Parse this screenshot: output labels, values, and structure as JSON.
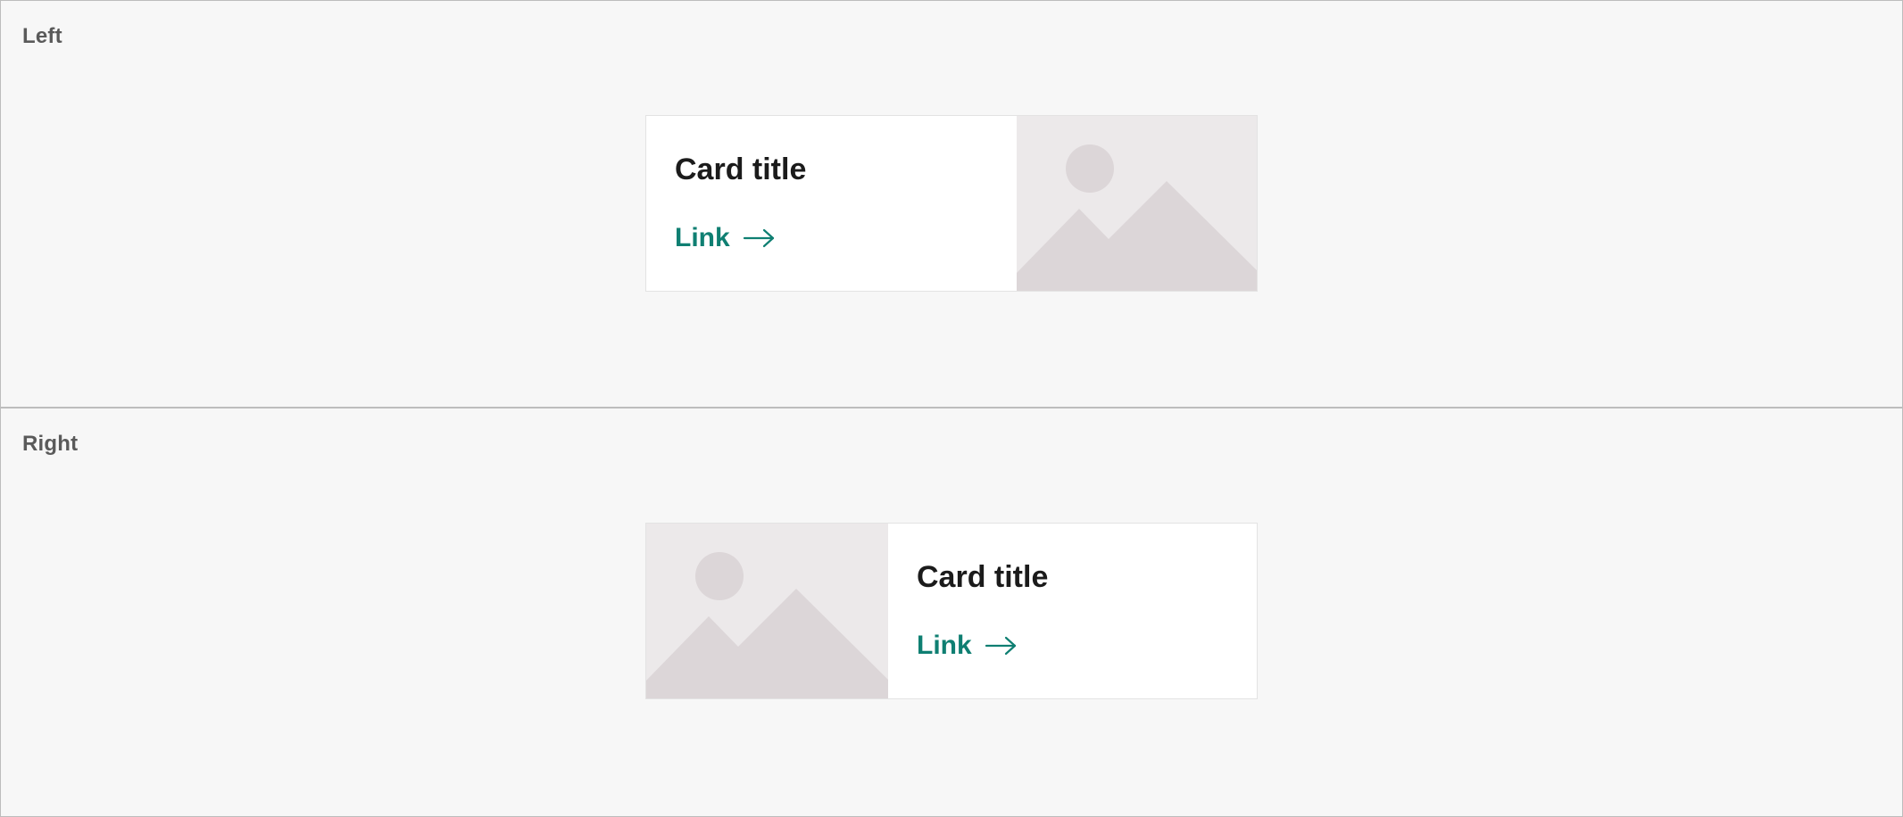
{
  "colors": {
    "page_background": "#f7f7f7",
    "panel_border": "#bdbdbd",
    "card_background": "#ffffff",
    "card_border": "#e3e3e3",
    "title_text": "#1b1b1b",
    "link_accent": "#0f7f72",
    "image_placeholder_bg": "#ece9ea",
    "image_placeholder_shape": "#dcd6d8",
    "panel_label_text": "#5a5a5a"
  },
  "panels": [
    {
      "label": "Left",
      "card": {
        "title": "Card title",
        "link_label": "Link",
        "link_icon": "arrow-right-icon",
        "image_icon": "image-placeholder-icon"
      }
    },
    {
      "label": "Right",
      "card": {
        "title": "Card title",
        "link_label": "Link",
        "link_icon": "arrow-right-icon",
        "image_icon": "image-placeholder-icon"
      }
    }
  ]
}
